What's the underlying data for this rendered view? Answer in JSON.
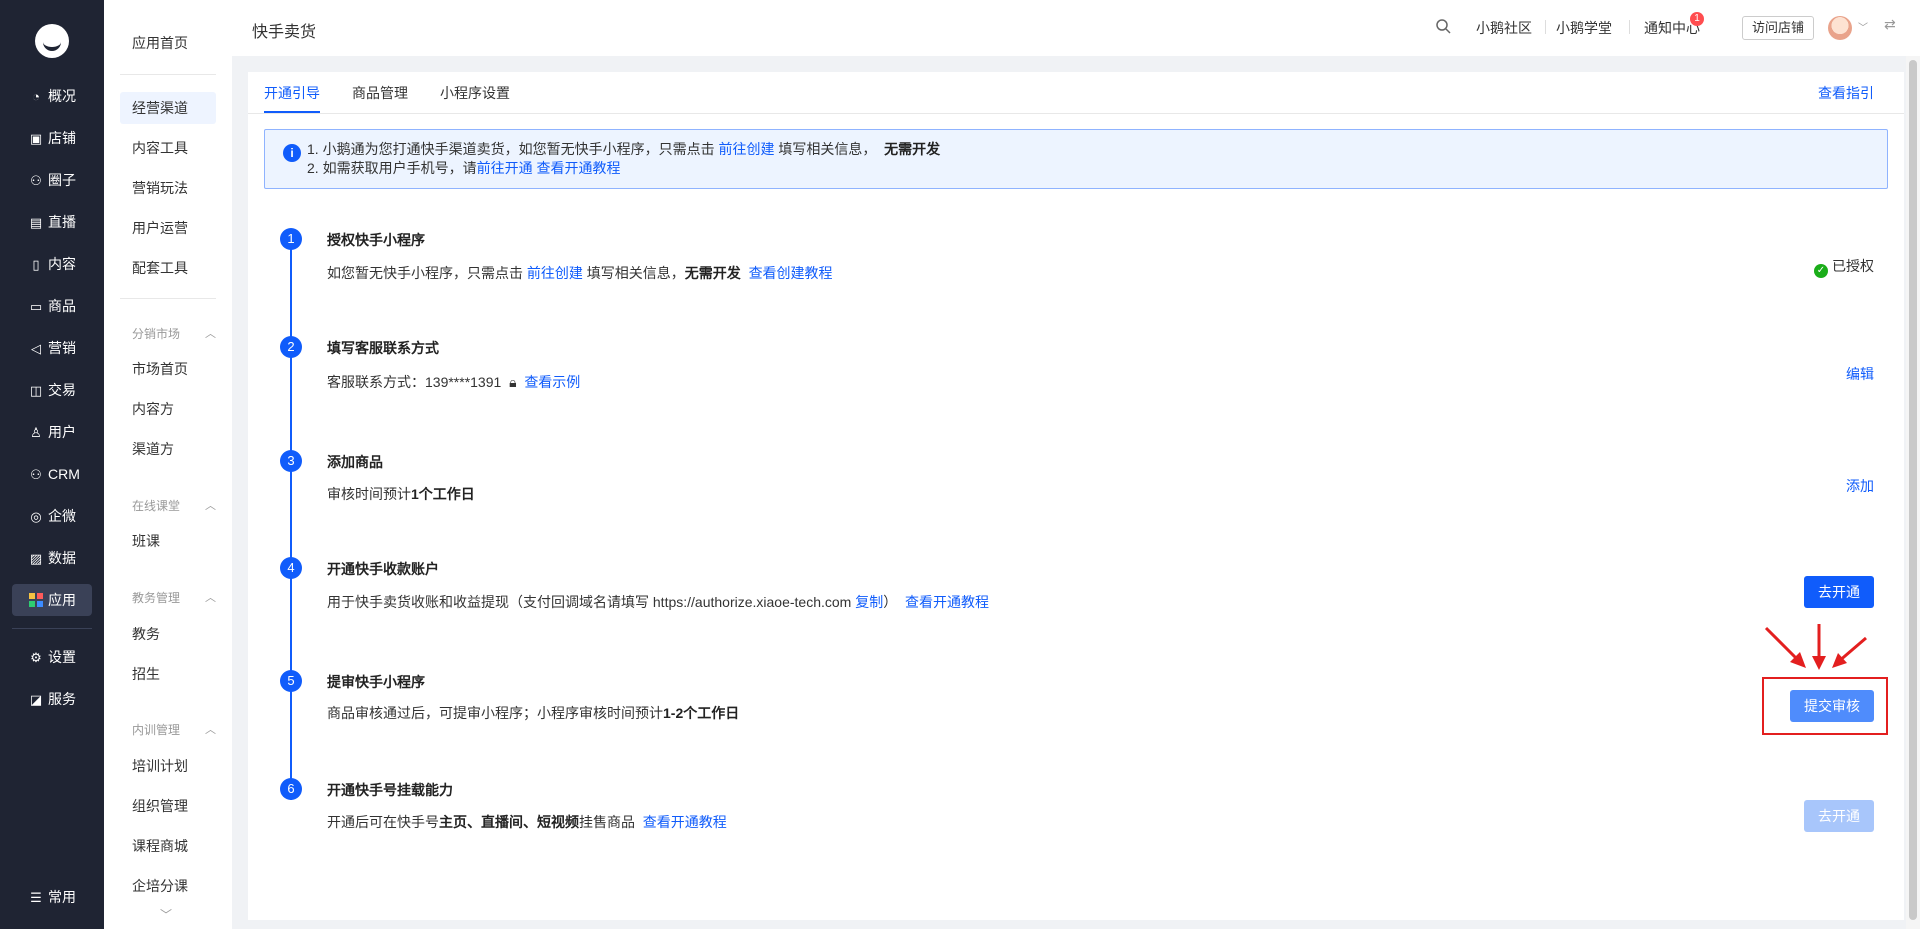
{
  "nav": {
    "items": [
      {
        "label": "概况",
        "icon": "pie-chart-icon"
      },
      {
        "label": "店铺",
        "icon": "store-icon"
      },
      {
        "label": "圈子",
        "icon": "group-icon"
      },
      {
        "label": "直播",
        "icon": "live-icon"
      },
      {
        "label": "内容",
        "icon": "document-icon"
      },
      {
        "label": "商品",
        "icon": "product-icon"
      },
      {
        "label": "营销",
        "icon": "megaphone-icon"
      },
      {
        "label": "交易",
        "icon": "transaction-icon"
      },
      {
        "label": "用户",
        "icon": "user-icon"
      },
      {
        "label": "CRM",
        "icon": "crm-icon"
      },
      {
        "label": "企微",
        "icon": "wecom-icon"
      },
      {
        "label": "数据",
        "icon": "data-icon"
      },
      {
        "label": "应用",
        "icon": "apps-icon"
      },
      {
        "label": "设置",
        "icon": "gear-icon"
      },
      {
        "label": "服务",
        "icon": "service-icon"
      }
    ],
    "bottom_label": "常用"
  },
  "sidebar": {
    "home": "应用首页",
    "channel": "经营渠道",
    "content_tools": "内容工具",
    "marketing": "营销玩法",
    "user_ops": "用户运营",
    "support_tools": "配套工具",
    "group_distribution": "分销市场",
    "market_home": "市场首页",
    "content_party": "内容方",
    "channel_party": "渠道方",
    "group_online_class": "在线课堂",
    "class": "班课",
    "group_edu": "教务管理",
    "edu": "教务",
    "enroll": "招生",
    "group_training": "内训管理",
    "training_plan": "培训计划",
    "org_mgmt": "组织管理",
    "course_mall": "课程商城",
    "enterprise_training": "企培分课"
  },
  "header": {
    "title": "快手卖货",
    "community": "小鹅社区",
    "school": "小鹅学堂",
    "notifications": "通知中心",
    "notification_count": "1",
    "visit_store": "访问店铺"
  },
  "tabs": {
    "t1": "开通引导",
    "t2": "商品管理",
    "t3": "小程序设置",
    "guide": "查看指引"
  },
  "notice": {
    "l1_a": "1. 小鹅通为您打通快手渠道卖货，如您暂无快手小程序，只需点击 ",
    "l1_link": "前往创建",
    "l1_b": " 填写相关信息，",
    "l1_bold": "无需开发",
    "l2_a": "2. 如需获取用户手机号，请",
    "l2_link1": "前往开通",
    "l2_link2": "查看开通教程"
  },
  "steps": {
    "s1": {
      "num": "1",
      "title": "授权快手小程序",
      "desc_a": "如您暂无快手小程序，只需点击 ",
      "desc_link": "前往创建",
      "desc_b": " 填写相关信息，",
      "desc_bold": "无需开发",
      "desc_link2": "查看创建教程",
      "status": "已授权"
    },
    "s2": {
      "num": "2",
      "title": "填写客服联系方式",
      "desc": "客服联系方式：139****1391",
      "desc_link": "查看示例",
      "action": "编辑"
    },
    "s3": {
      "num": "3",
      "title": "添加商品",
      "desc_a": "审核时间预计",
      "desc_bold": "1个工作日",
      "action": "添加"
    },
    "s4": {
      "num": "4",
      "title": "开通快手收款账户",
      "desc_a": "用于快手卖货收账和收益提现（支付回调域名请填写 https://authorize.xiaoe-tech.com ",
      "desc_copy": "复制",
      "desc_b": "）",
      "desc_link": "查看开通教程",
      "button": "去开通"
    },
    "s5": {
      "num": "5",
      "title": "提审快手小程序",
      "desc_a": "商品审核通过后，可提审小程序；小程序审核时间预计",
      "desc_bold": "1-2个工作日",
      "button": "提交审核"
    },
    "s6": {
      "num": "6",
      "title": "开通快手号挂载能力",
      "desc_a": "开通后可在快手号",
      "desc_bold": "主页、直播间、短视频",
      "desc_b": "挂售商品",
      "desc_link": "查看开通教程",
      "button": "去开通"
    }
  },
  "colors": {
    "accent": "#105cfb",
    "nav_bg": "#1f2433",
    "highlight": "#e31f1f"
  }
}
